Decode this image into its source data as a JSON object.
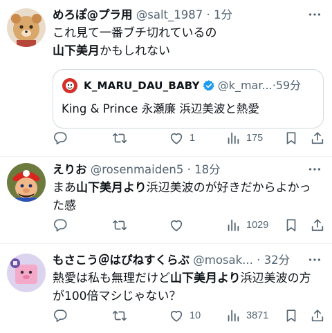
{
  "tweets": [
    {
      "name": "めろぽ@プラ用",
      "handle": "@salt_1987",
      "time": "1分",
      "text_line1": "これ見て一番ブチ切れているの",
      "text_line2_bold": "山下美月",
      "text_line2_rest": "かもしれない",
      "quote": {
        "name": "K_MARU_DAU_BABY",
        "handle": "@k_mar...",
        "time": "59分",
        "text": "King & Prince 永瀬廉 浜辺美波と熱愛"
      },
      "reply_count": "",
      "retweet_count": "",
      "like_count": "1",
      "view_count": "175"
    },
    {
      "name": "えりお",
      "handle": "@rosenmaiden5",
      "time": "18分",
      "text_a": "まあ",
      "text_b_bold": "山下美月より",
      "text_c": "浜辺美波のが好きだからよかっ",
      "text_line2": "た感",
      "reply_count": "",
      "retweet_count": "",
      "like_count": "",
      "view_count": "1029"
    },
    {
      "name": "もさこう＠はぴねすくらぶ",
      "handle": "@mosak...",
      "time": "32分",
      "text_a": "熱愛は私も無理だけど",
      "text_b_bold": "山下美月より",
      "text_c": "浜辺美波の方",
      "text_line2": "が100倍マシじゃない？",
      "reply_count": "",
      "retweet_count": "",
      "like_count": "10",
      "view_count": "3871"
    }
  ],
  "dot": "·",
  "colors": {
    "text": "#0f1419",
    "secondary": "#536471",
    "verified": "#1d9bf0",
    "border": "#cfd9de"
  }
}
